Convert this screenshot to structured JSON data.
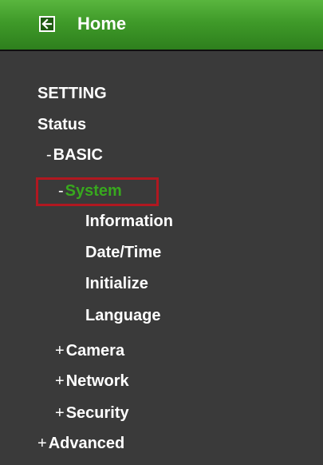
{
  "header": {
    "home_label": "Home",
    "home_icon": "back-arrow-icon",
    "bg_color": "#3f9a29"
  },
  "menu": {
    "setting_label": "SETTING",
    "status_label": "Status",
    "basic": {
      "marker": "-",
      "label": "BASIC"
    },
    "system": {
      "marker": "-",
      "label": "System",
      "color": "#38a81e",
      "highlight_color": "#b11820"
    },
    "system_items": [
      "Information",
      "Date/Time",
      "Initialize",
      "Language"
    ],
    "camera": {
      "marker": "+",
      "label": "Camera"
    },
    "network": {
      "marker": "+",
      "label": "Network"
    },
    "security": {
      "marker": "+",
      "label": "Security"
    },
    "advanced": {
      "marker": "+",
      "label": "Advanced"
    }
  }
}
